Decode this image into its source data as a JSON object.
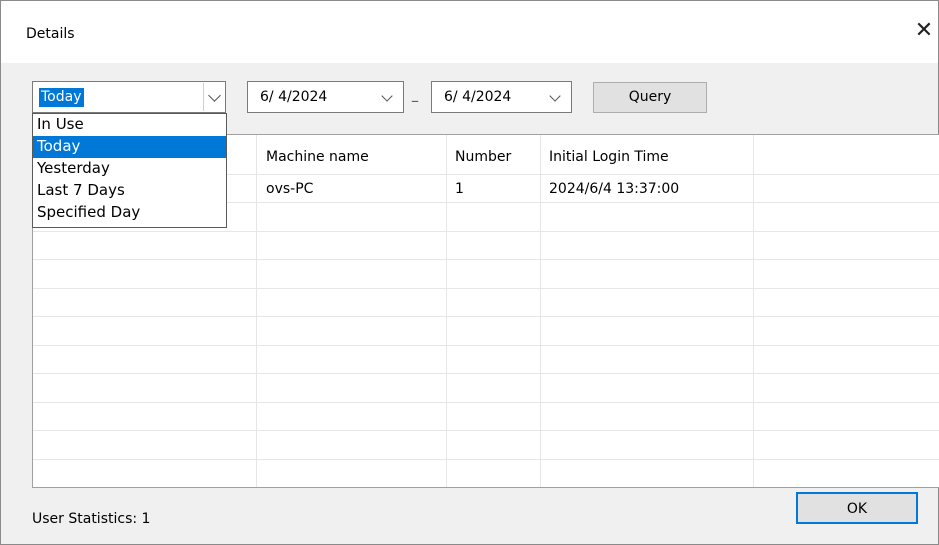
{
  "window": {
    "title": "Details",
    "close_glyph": "✕"
  },
  "filter": {
    "selected": "Today",
    "options": [
      "In Use",
      "Today",
      "Yesterday",
      "Last 7 Days",
      "Specified Day"
    ],
    "highlighted_index": 1
  },
  "date_from": "6/ 4/2024",
  "date_separator": "–",
  "date_to": "6/ 4/2024",
  "query_label": "Query",
  "table": {
    "headers": [
      "",
      "Machine name",
      "Number",
      "Initial Login Time",
      ""
    ],
    "rows": [
      [
        "",
        "ovs-PC",
        "1",
        "2024/6/4 13:37:00",
        ""
      ]
    ]
  },
  "status": {
    "label": "User Statistics:",
    "value": "1"
  },
  "ok_label": "OK",
  "colors": {
    "accent": "#0078d7",
    "highlight_text": "#ffffff"
  }
}
